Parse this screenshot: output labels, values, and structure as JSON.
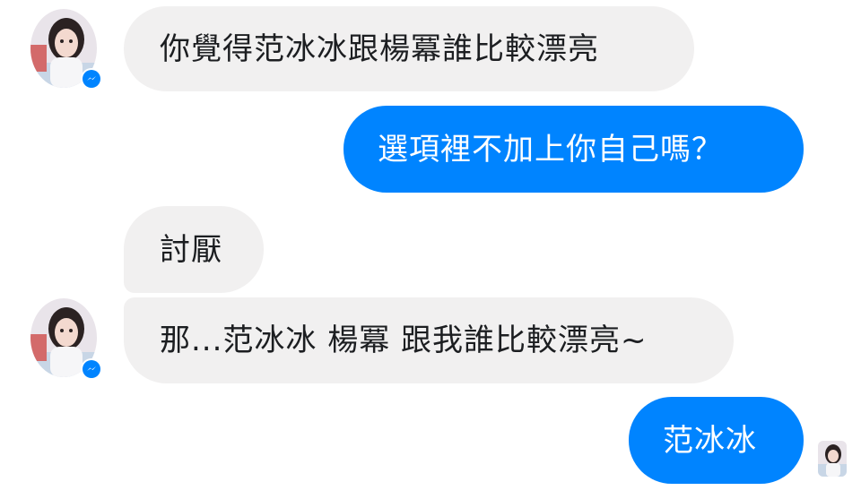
{
  "conversation": {
    "messages": [
      {
        "sender": "contact",
        "text": "你覺得范冰冰跟楊冪誰比較漂亮"
      },
      {
        "sender": "me",
        "text": "選項裡不加上你自己嗎？"
      },
      {
        "sender": "contact",
        "text": "討厭"
      },
      {
        "sender": "contact",
        "text": "那...范冰冰 楊冪 跟我誰比較漂亮~"
      },
      {
        "sender": "me",
        "text": "范冰冰"
      }
    ]
  },
  "colors": {
    "outgoing_bubble": "#0084ff",
    "incoming_bubble": "#f1f0f0",
    "messenger_badge": "#0084ff"
  },
  "icons": {
    "contact_avatar": "contact-avatar-icon",
    "messenger_badge": "messenger-icon",
    "seen_indicator": "seen-avatar-icon"
  }
}
